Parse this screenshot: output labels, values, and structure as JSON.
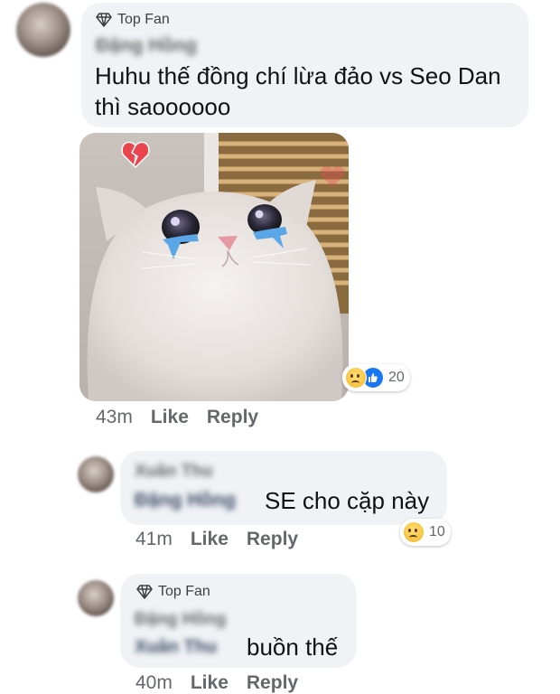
{
  "comment1": {
    "badge": "Top Fan",
    "author": "Đặng Hồng",
    "text_line1": "Huhu thế đồng chí lừa đảo vs Seo Dan",
    "text_line2": "thì saoooooo",
    "time": "43m",
    "like_label": "Like",
    "reply_label": "Reply",
    "reaction_count": "20",
    "reaction_icons": [
      "sad-emoji",
      "like-emoji"
    ]
  },
  "reply1": {
    "author": "Xuân Thu",
    "mention": "Đặng Hồng",
    "text": "SE cho cặp này",
    "time": "41m",
    "like_label": "Like",
    "reply_label": "Reply",
    "reaction_count": "10",
    "reaction_icons": [
      "sad-emoji"
    ]
  },
  "reply2": {
    "badge": "Top Fan",
    "author": "Đặng Hồng",
    "mention": "Xuân Thu",
    "text": "buồn thế",
    "time": "40m",
    "like_label": "Like",
    "reply_label": "Reply"
  },
  "colors": {
    "bubble": "#f0f2f5",
    "meta_text": "#65676b",
    "like_blue": "#1877f2",
    "broken_heart": "#e8454f"
  }
}
